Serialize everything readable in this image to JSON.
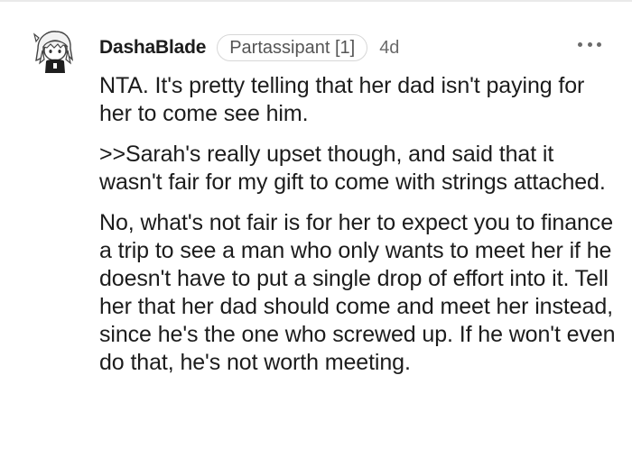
{
  "comment": {
    "author": "DashaBlade",
    "flair": "Partassipant [1]",
    "age": "4d",
    "more_icon": "more-horizontal-icon",
    "avatar_icon": "snoo-avatar-icon",
    "paragraphs": [
      "NTA. It's pretty telling that her dad isn't paying for her to come see him.",
      ">>Sarah's really upset though, and said that it wasn't fair for my gift to come with strings attached.",
      "No, what's not fair is for her to expect you to finance a trip to see a man who only wants to meet her if he doesn't have to put a single drop of effort into it. Tell her that her dad should come and meet her instead, since he's the one who screwed up. If he won't even do that, he's not worth meeting."
    ]
  }
}
